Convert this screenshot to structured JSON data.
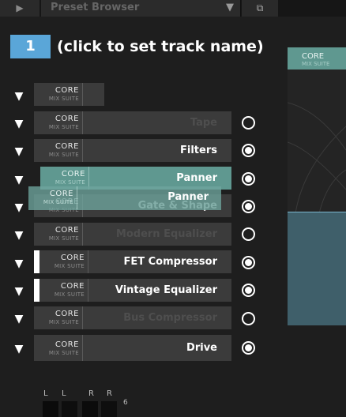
{
  "topbar": {
    "play_glyph": "▶",
    "preset_label": "Preset Browser",
    "dropdown_glyph": "▼",
    "window_glyph": "⧉"
  },
  "track": {
    "number": "1",
    "name_prompt": "(click to set track name)"
  },
  "logo": {
    "core": "CORE",
    "mix_suite": "MIX SUITE"
  },
  "expand_glyph": "▼",
  "modules": [
    {
      "label": "",
      "enabled": true
    },
    {
      "label": "Tape",
      "enabled": false
    },
    {
      "label": "Filters",
      "enabled": true
    },
    {
      "label": "Panner",
      "enabled": true,
      "dragging": true
    },
    {
      "label": "Gate & Shape",
      "enabled": true
    },
    {
      "label": "Modern Equalizer",
      "enabled": false
    },
    {
      "label": "FET Compressor",
      "enabled": true
    },
    {
      "label": "Vintage Equalizer",
      "enabled": true
    },
    {
      "label": "Bus Compressor",
      "enabled": false
    },
    {
      "label": "Drive",
      "enabled": true
    }
  ],
  "drag_ghost": {
    "label": "Panner"
  },
  "right_panel": {
    "core": "CORE",
    "mix_suite": "MIX SUITE"
  },
  "meters": {
    "labels": [
      "L",
      "L",
      "R",
      "R"
    ],
    "scale_value": "6"
  },
  "colors": {
    "accent_blue": "#5aa6d8",
    "teal_drag": "#5f9890",
    "enabled_text": "#ffffff",
    "disabled_text": "#4e4e4e"
  }
}
